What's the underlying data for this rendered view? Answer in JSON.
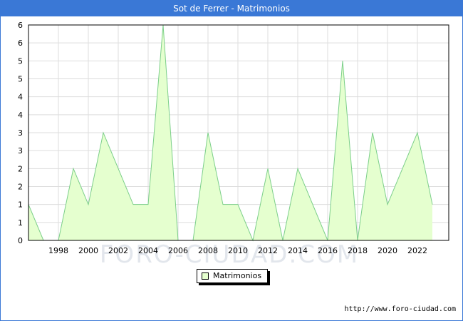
{
  "header": {
    "title": "Sot de Ferrer - Matrimonios"
  },
  "watermark": "FORO-CIUDAD.COM",
  "source": "http://www.foro-ciudad.com",
  "colors": {
    "header_bg": "#3a78d6",
    "fill": "#e5ffcf",
    "line": "#7ccf8a",
    "grid": "#dddddd"
  },
  "chart_data": {
    "type": "area",
    "x": [
      1996,
      1997,
      1998,
      1999,
      2000,
      2001,
      2002,
      2003,
      2004,
      2005,
      2006,
      2007,
      2008,
      2009,
      2010,
      2011,
      2012,
      2013,
      2014,
      2015,
      2016,
      2017,
      2018,
      2019,
      2020,
      2021,
      2022,
      2023
    ],
    "series": [
      {
        "name": "Matrimonios",
        "values": [
          1,
          0,
          0,
          2,
          1,
          3,
          2,
          1,
          1,
          6,
          0,
          0,
          3,
          1,
          1,
          0,
          2,
          0,
          2,
          1,
          0,
          5,
          0,
          3,
          1,
          2,
          3,
          1
        ]
      }
    ],
    "x_tick_labels": [
      "1998",
      "2000",
      "2002",
      "2004",
      "2006",
      "2008",
      "2010",
      "2012",
      "2014",
      "2016",
      "2018",
      "2020",
      "2022"
    ],
    "y_tick_labels": [
      "0",
      "1",
      "1",
      "2",
      "2",
      "3",
      "3",
      "4",
      "4",
      "5",
      "5",
      "6",
      "6"
    ],
    "ylim": [
      0,
      6
    ],
    "grid": true,
    "legend": "bottom-center"
  }
}
